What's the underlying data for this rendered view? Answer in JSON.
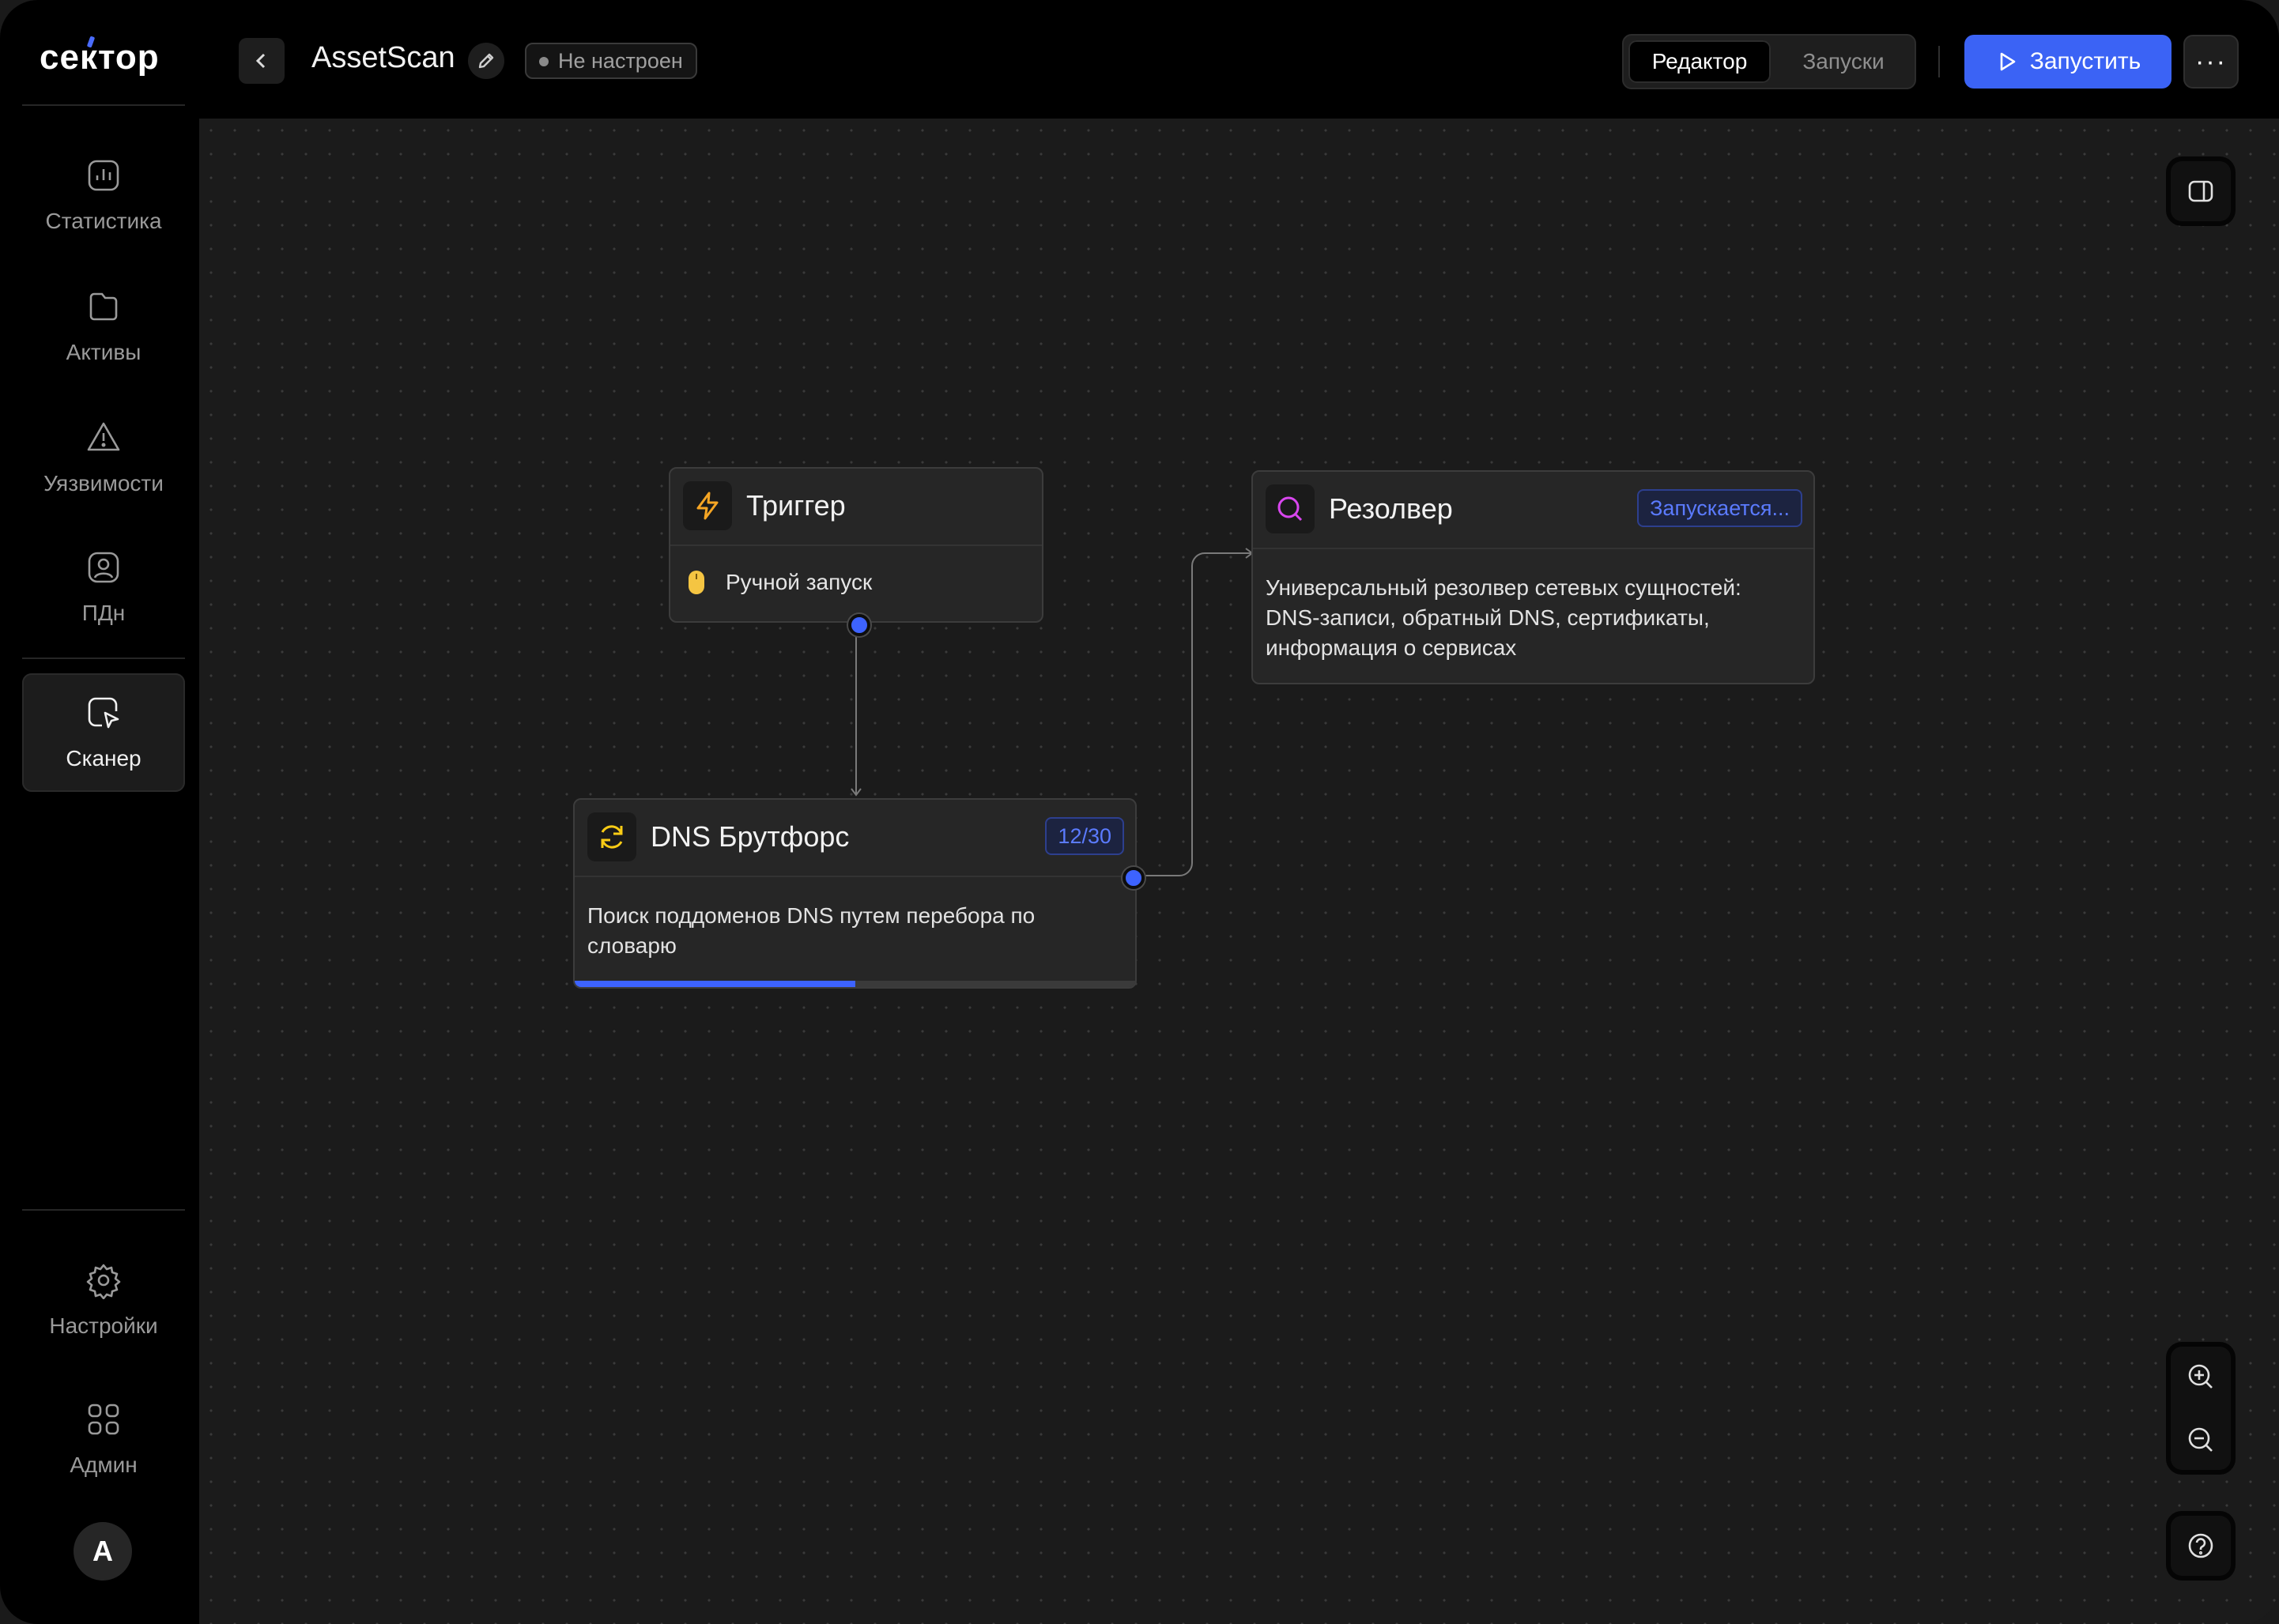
{
  "app": {
    "logo": "сектор"
  },
  "sidebar": {
    "items": [
      {
        "label": "Статистика",
        "icon": "chart-icon"
      },
      {
        "label": "Активы",
        "icon": "folder-icon"
      },
      {
        "label": "Уязвимости",
        "icon": "warning-icon"
      },
      {
        "label": "ПДн",
        "icon": "user-icon"
      },
      {
        "label": "Сканер",
        "icon": "scanner-icon",
        "active": true
      }
    ],
    "bottom_items": [
      {
        "label": "Настройки",
        "icon": "gear-icon"
      },
      {
        "label": "Админ",
        "icon": "grid-icon"
      }
    ],
    "avatar_initial": "A"
  },
  "header": {
    "title": "AssetScan",
    "status": "Не настроен",
    "tabs": [
      {
        "label": "Редактор",
        "active": true
      },
      {
        "label": "Запуски",
        "active": false
      }
    ],
    "run_label": "Запустить",
    "more_label": "···"
  },
  "nodes": {
    "trigger": {
      "title": "Триггер",
      "item": "Ручной запуск",
      "icon": "lightning-icon"
    },
    "resolver": {
      "title": "Резолвер",
      "badge": "Запускается...",
      "description": "Универсальный резолвер сетевых сущностей: DNS-записи, обратный DNS, сертификаты, информация о сервисах",
      "icon": "search-icon"
    },
    "dns": {
      "title": "DNS Брутфорс",
      "badge": "12/30",
      "description": "Поиск поддоменов DNS путем перебора по словарю",
      "icon": "refresh-icon",
      "progress": 0.5
    }
  },
  "colors": {
    "accent": "#3b63f5",
    "trigger_icon": "#f5a524",
    "resolver_icon": "#d946ef",
    "dns_icon": "#facc15",
    "background": "#1b1b1b"
  }
}
